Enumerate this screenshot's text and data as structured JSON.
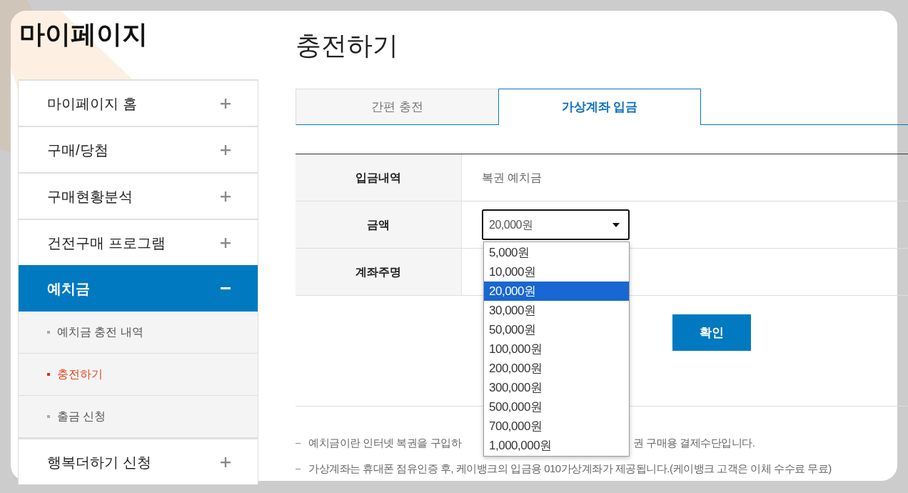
{
  "sidebar": {
    "title": "마이페이지",
    "items": [
      {
        "label": "마이페이지 홈",
        "expanded": false
      },
      {
        "label": "구매/당첨",
        "expanded": false
      },
      {
        "label": "구매현황분석",
        "expanded": false
      },
      {
        "label": "건전구매 프로그램",
        "expanded": false
      },
      {
        "label": "예치금",
        "expanded": true,
        "children": [
          {
            "label": "예치금 충전 내역",
            "selected": false
          },
          {
            "label": "충전하기",
            "selected": true
          },
          {
            "label": "출금 신청",
            "selected": false
          }
        ]
      },
      {
        "label": "행복더하기 신청",
        "expanded": false
      }
    ]
  },
  "page_title": "충전하기",
  "tabs": [
    {
      "label": "간편 충전",
      "selected": false
    },
    {
      "label": "가상계좌 입금",
      "selected": true
    }
  ],
  "form": {
    "rows": [
      {
        "label": "입금내역",
        "kind": "text",
        "value": "복권 예치금"
      },
      {
        "label": "금액",
        "kind": "select",
        "value": "20,000원",
        "open": true,
        "options": [
          {
            "label": "5,000원",
            "selected": false
          },
          {
            "label": "10,000원",
            "selected": false
          },
          {
            "label": "20,000원",
            "selected": true
          },
          {
            "label": "30,000원",
            "selected": false
          },
          {
            "label": "50,000원",
            "selected": false
          },
          {
            "label": "100,000원",
            "selected": false
          },
          {
            "label": "200,000원",
            "selected": false
          },
          {
            "label": "300,000원",
            "selected": false
          },
          {
            "label": "500,000원",
            "selected": false
          },
          {
            "label": "700,000원",
            "selected": false
          },
          {
            "label": "1,000,000원",
            "selected": false
          }
        ]
      },
      {
        "label": "계좌주명",
        "kind": "blank"
      }
    ]
  },
  "confirm_button": "확인",
  "notes": [
    {
      "segments": [
        "예치금이란 인터넷 복권을 구입하",
        "권 구매용 결제수단입니다."
      ]
    },
    {
      "segments": [
        "가상계좌는 휴대폰 점유인증 후, 케이뱅크의 입금용 010가상계좌가 제공됩니다.(케이뱅크 고객은 이체 수수료 무료)"
      ]
    }
  ]
}
